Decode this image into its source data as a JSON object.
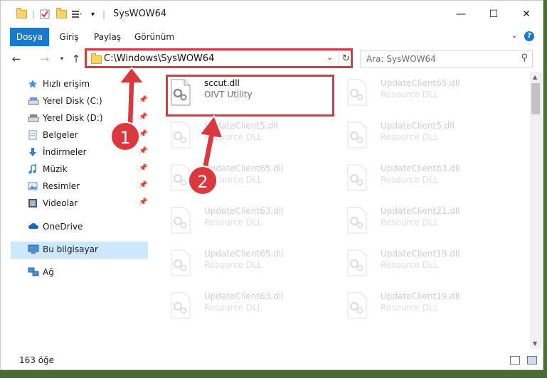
{
  "window": {
    "title": "SysWOW64",
    "minimize": "—",
    "maximize": "☐",
    "close": "✕"
  },
  "ribbon": {
    "tabs": [
      "Dosya",
      "Giriş",
      "Paylaş",
      "Görünüm"
    ],
    "help": "?"
  },
  "address": {
    "path": "C:\\Windows\\SysWOW64",
    "search_placeholder": "Ara: SysWOW64"
  },
  "nav": {
    "items": [
      {
        "label": "Hızlı erişim",
        "icon": "star-icon",
        "pinned": false,
        "selected": false
      },
      {
        "label": "Yerel Disk (C:)",
        "icon": "drive-icon",
        "pinned": true,
        "selected": false
      },
      {
        "label": "Yerel Disk (D:)",
        "icon": "drive-icon",
        "pinned": true,
        "selected": false
      },
      {
        "label": "Belgeler",
        "icon": "documents-icon",
        "pinned": true,
        "selected": false
      },
      {
        "label": "İndirmeler",
        "icon": "download-icon",
        "pinned": true,
        "selected": false
      },
      {
        "label": "Müzik",
        "icon": "music-icon",
        "pinned": true,
        "selected": false
      },
      {
        "label": "Resimler",
        "icon": "pictures-icon",
        "pinned": true,
        "selected": false
      },
      {
        "label": "Videolar",
        "icon": "video-icon",
        "pinned": true,
        "selected": false
      },
      {
        "label": "OneDrive",
        "icon": "cloud-icon",
        "pinned": false,
        "selected": false
      },
      {
        "label": "Bu bilgisayar",
        "icon": "computer-icon",
        "pinned": false,
        "selected": true
      },
      {
        "label": "Ağ",
        "icon": "network-icon",
        "pinned": false,
        "selected": false
      }
    ]
  },
  "files": [
    {
      "name": "sccut.dll",
      "desc": "OIVT Utility",
      "highlighted": true
    },
    {
      "name": "UpdateClient65.dll",
      "desc": "Resource DLL"
    },
    {
      "name": "UpdateClient5.dll",
      "desc": "Resource DLL"
    },
    {
      "name": "UpdateClient5.dll",
      "desc": "Resource DLL"
    },
    {
      "name": "UpdateClient65.dll",
      "desc": "Resource DLL"
    },
    {
      "name": "UpdateClient63.dll",
      "desc": "Resource DLL"
    },
    {
      "name": "UpdateClient63.dll",
      "desc": "Resource DLL"
    },
    {
      "name": "UpdateClient21.dll",
      "desc": "Resource DLL"
    },
    {
      "name": "UpdateClient65.dll",
      "desc": "Resource DLL"
    },
    {
      "name": "UpdateClient19.dll",
      "desc": "Resource DLL"
    },
    {
      "name": "UpdateClient63.dll",
      "desc": "Resource DLL"
    },
    {
      "name": "UpdateClient19.dll",
      "desc": "Resource DLL"
    }
  ],
  "status": {
    "count": "163 öğe"
  },
  "annotations": {
    "step1": "1",
    "step2": "2",
    "color": "#d9383e"
  }
}
